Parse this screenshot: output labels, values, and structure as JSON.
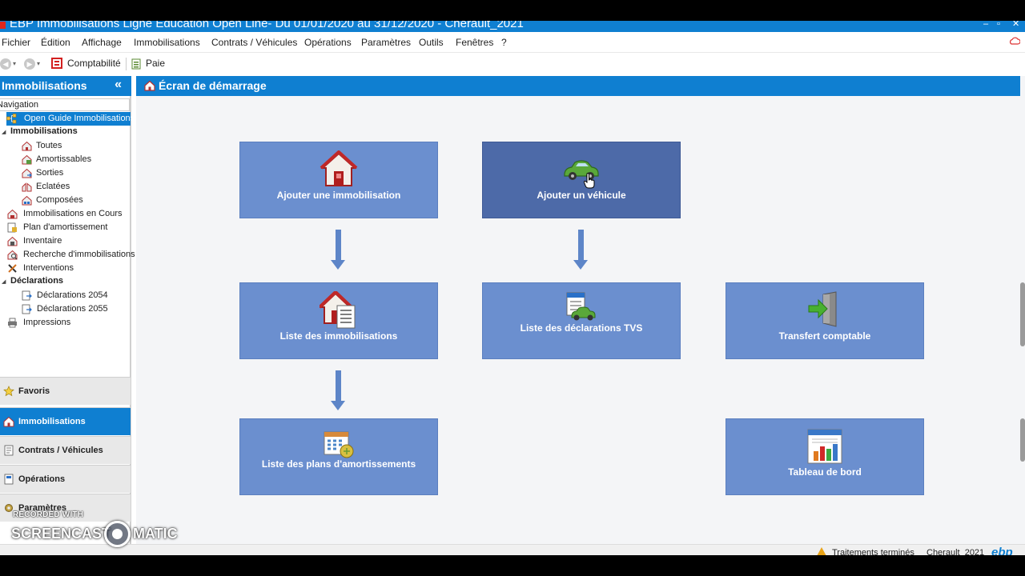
{
  "window": {
    "title": "EBP Immobilisations Ligne Education Open Line- Du 01/01/2020 au 31/12/2020 - Cherault_2021",
    "controls": {
      "minimize": "–",
      "restore": "▫",
      "close": "✕"
    }
  },
  "menu": {
    "items": [
      "Fichier",
      "Édition",
      "Affichage",
      "Immobilisations",
      "Contrats / Véhicules",
      "Opérations",
      "Paramètres",
      "Outils",
      "Fenêtres",
      "?"
    ]
  },
  "toolbar": {
    "back": "◀",
    "forward": "▶",
    "caret": "▾",
    "comptabilite": "Comptabilité",
    "paie": "Paie"
  },
  "sidebar": {
    "title": "Immobilisations",
    "collapse": "«",
    "nav_label": "Navigation",
    "tree": {
      "guide": "Open Guide Immobilisations",
      "group1": "Immobilisations",
      "group1_items": [
        "Toutes",
        "Amortissables",
        "Sorties",
        "Eclatées",
        "Composées"
      ],
      "items": [
        "Immobilisations en Cours",
        "Plan d'amortissement",
        "Inventaire",
        "Recherche d'immobilisations",
        "Interventions"
      ],
      "group2": "Déclarations",
      "group2_items": [
        "Déclarations 2054",
        "Déclarations 2055"
      ],
      "impressions": "Impressions"
    },
    "bottom": [
      "Favoris",
      "Immobilisations",
      "Contrats / Véhicules",
      "Opérations",
      "Paramètres"
    ]
  },
  "main": {
    "title": "Écran de démarrage",
    "tiles": {
      "ajouter_immo": "Ajouter une immobilisation",
      "ajouter_vehicule": "Ajouter un véhicule",
      "liste_immo": "Liste des immobilisations",
      "liste_tvs": "Liste des déclarations TVS",
      "transfert": "Transfert comptable",
      "plans": "Liste des plans d'amortissements",
      "tableau": "Tableau de bord"
    }
  },
  "status": {
    "message": "Traitements terminés",
    "company": "Cherault_2021",
    "logo": "ebp"
  },
  "watermark": {
    "recorded": "RECORDED WITH",
    "screencast": "SCREENCAST",
    "matic": "MATIC"
  },
  "colors": {
    "accent": "#0f7fd1",
    "tile": "#6b8fcf",
    "tile_hover": "#4d6aa8",
    "arrow": "#5d85c8"
  }
}
